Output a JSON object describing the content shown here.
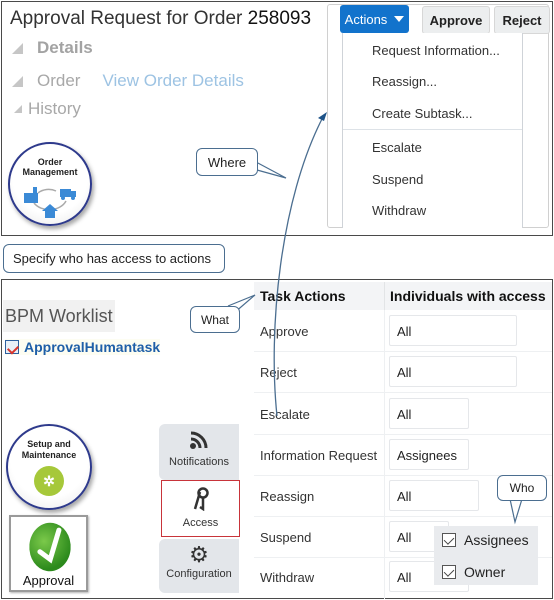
{
  "top_panel": {
    "title": "Approval Request for Order",
    "order_number": "258093",
    "tree": {
      "details_label": "Details",
      "order_label": "Order",
      "view_order_link": "View Order Details",
      "history_label": "History"
    },
    "order_management_tile": {
      "line1": "Order",
      "line2": "Management",
      "icon": "factory-truck-home-icon"
    },
    "toolbar": {
      "actions_label": "Actions",
      "approve_label": "Approve",
      "reject_label": "Reject"
    },
    "actions_menu": {
      "group1": [
        "Request Information...",
        "Reassign...",
        "Create Subtask..."
      ],
      "group2": [
        "Escalate",
        "Suspend",
        "Withdraw"
      ]
    }
  },
  "callouts": {
    "where": "Where",
    "specify": "Specify who has access to actions",
    "what": "What",
    "who": "Who"
  },
  "bottom_panel": {
    "app_title": "BPM Worklist",
    "task_link": "ApprovalHumantask",
    "setup_tile": {
      "line1": "Setup and",
      "line2": "Maintenance",
      "icon": "gears-icon"
    },
    "approval_tile": {
      "label": "Approval",
      "icon": "checkmark-icon"
    },
    "side_tabs": [
      {
        "label": "Notifications",
        "icon": "rss-icon",
        "active": false
      },
      {
        "label": "Access",
        "icon": "keys-icon",
        "active": true
      },
      {
        "label": "Configuration",
        "icon": "gear-icon",
        "active": false
      }
    ],
    "table": {
      "headers": [
        "Task Actions",
        "Individuals with access"
      ],
      "rows": [
        {
          "action": "Approve",
          "access": "All"
        },
        {
          "action": "Reject",
          "access": "All"
        },
        {
          "action": "Escalate",
          "access": "All"
        },
        {
          "action": "Information Request",
          "access": "Assignees"
        },
        {
          "action": "Reassign",
          "access": "All"
        },
        {
          "action": "Suspend",
          "access": "All"
        },
        {
          "action": "Withdraw",
          "access": "All"
        }
      ]
    },
    "who_options": [
      {
        "label": "Assignees",
        "checked": true
      },
      {
        "label": "Owner",
        "checked": true
      }
    ]
  }
}
